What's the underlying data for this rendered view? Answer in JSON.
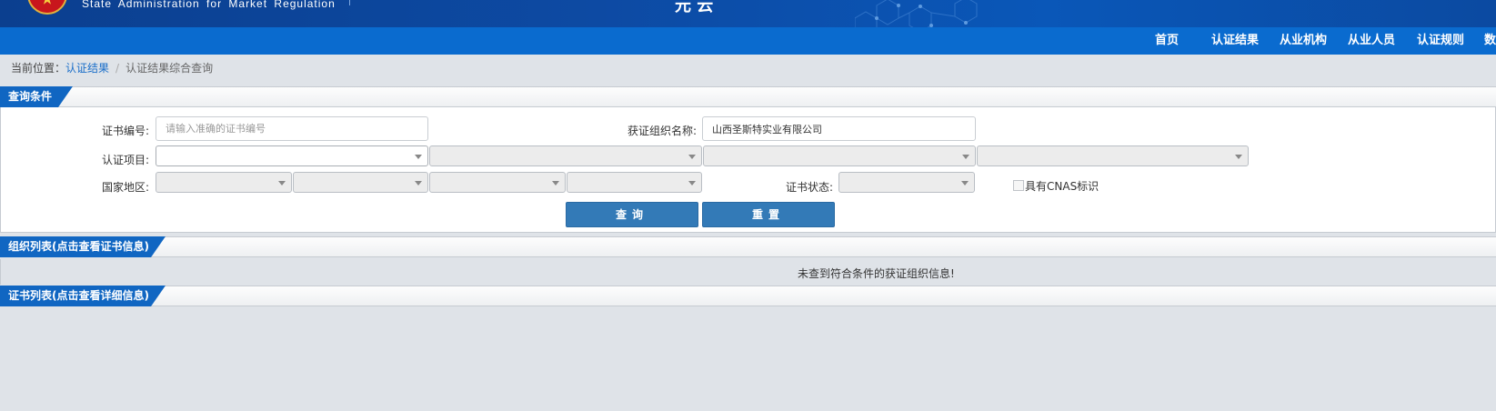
{
  "header": {
    "en_title": "State Administration  for  Market Regulation",
    "cn_partial": "元 云"
  },
  "nav": {
    "items": [
      {
        "label": "首页"
      },
      {
        "label": "认证结果"
      },
      {
        "label": "从业机构"
      },
      {
        "label": "从业人员"
      },
      {
        "label": "认证规则"
      },
      {
        "label": "数"
      }
    ]
  },
  "breadcrumb": {
    "prefix": "当前位置：",
    "link": "认证结果",
    "separator": "/",
    "current": "认证结果综合查询"
  },
  "query": {
    "title": "查询条件",
    "cert_no_label": "证书编号:",
    "cert_no_placeholder": "请输入准确的证书编号",
    "cert_no_value": "",
    "org_name_label": "获证组织名称:",
    "org_name_value": "山西圣斯特实业有限公司",
    "project_label": "认证项目:",
    "region_label": "国家地区:",
    "status_label": "证书状态:",
    "cnas_label": "具有CNAS标识",
    "search_button": "查询",
    "reset_button": "重置"
  },
  "org_list": {
    "title": "组织列表(点击查看证书信息)",
    "empty_message": "未查到符合条件的获证组织信息!"
  },
  "cert_list": {
    "title": "证书列表(点击查看详细信息)"
  },
  "colors": {
    "nav_bg": "#0a6bcf",
    "tab_bg": "#1066c2",
    "button_bg": "#337ab7",
    "link": "#1a6ec9"
  }
}
